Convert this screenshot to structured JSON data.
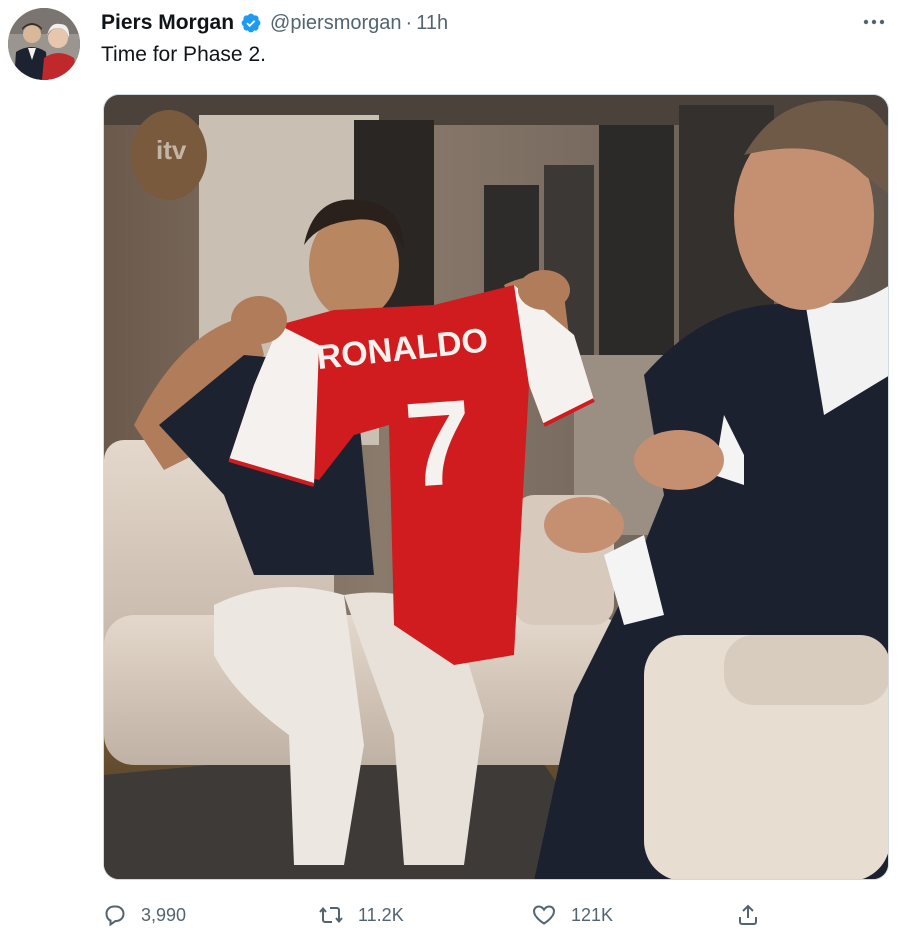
{
  "author": {
    "display_name": "Piers Morgan",
    "handle": "@piersmorgan",
    "separator": "·",
    "time": "11h",
    "verified": true,
    "avatar_icon": "profile-photo"
  },
  "tweet": {
    "text": "Time for Phase 2."
  },
  "media": {
    "type": "photo",
    "jersey_name": "RONALDO",
    "jersey_number": "7",
    "watermark": "itv"
  },
  "actions": {
    "reply_count": "3,990",
    "retweet_count": "11.2K",
    "like_count": "121K"
  },
  "colors": {
    "text": "#0f1419",
    "secondary": "#536471",
    "verified_blue": "#1d9bf0",
    "jersey_red": "#d01c1f"
  }
}
